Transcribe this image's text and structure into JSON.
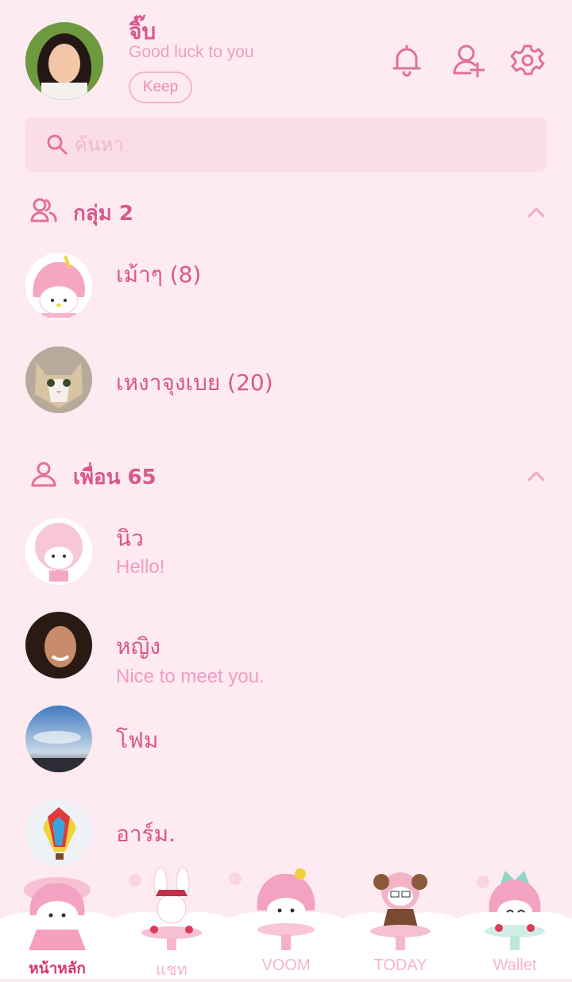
{
  "profile": {
    "name": "จิ๊บ",
    "status": "Good luck to you",
    "keep_label": "Keep"
  },
  "search": {
    "placeholder": "ค้นหา"
  },
  "groups": {
    "title": "กลุ่ม 2",
    "items": [
      {
        "name": "เม้าๆ (8)"
      },
      {
        "name": "เหงาจุงเบย (20)"
      }
    ]
  },
  "friends": {
    "title": "เพื่อน 65",
    "items": [
      {
        "name": "นิว",
        "status": "Hello!"
      },
      {
        "name": "หญิง",
        "status": "Nice to meet you."
      },
      {
        "name": "โฟม"
      },
      {
        "name": "อาร์ม."
      }
    ]
  },
  "nav": {
    "items": [
      {
        "label": "หน้าหลัก"
      },
      {
        "label": "แชท"
      },
      {
        "label": "VOOM"
      },
      {
        "label": "TODAY"
      },
      {
        "label": "Wallet"
      }
    ]
  },
  "colors": {
    "background": "#feeaf1",
    "accent": "#d9588a",
    "active_nav": "#d9346f",
    "muted": "#f09cc0"
  }
}
